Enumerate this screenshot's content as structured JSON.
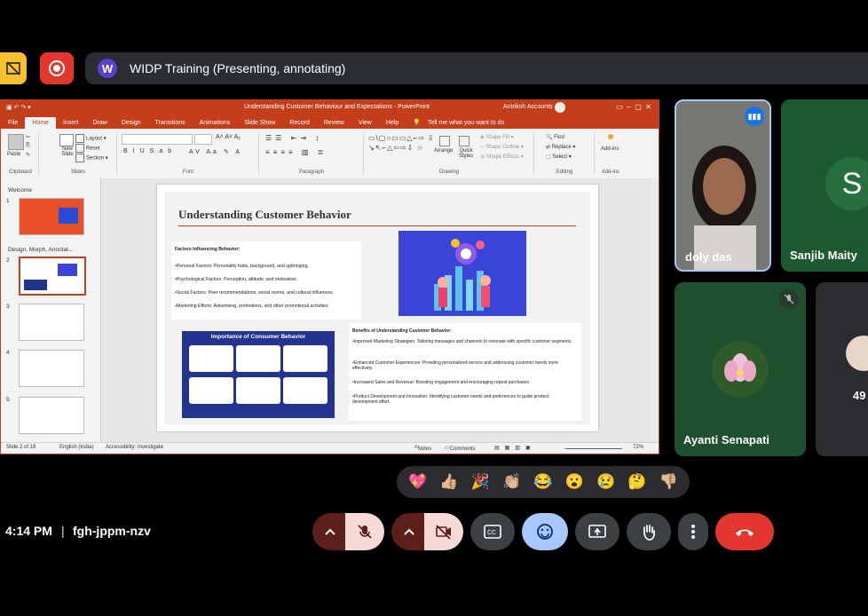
{
  "meeting": {
    "presenting_title": "WIDP Training (Presenting, annotating)",
    "presenter_initial": "W",
    "time": "4:14 PM",
    "separator": "|",
    "code": "fgh-jppm-nzv"
  },
  "ppt": {
    "window_title": "Understanding Customer Behaviour and Expectations  -  PowerPoint",
    "account": "Antriksh Accounts",
    "menu": [
      "File",
      "Home",
      "Insert",
      "Draw",
      "Design",
      "Transitions",
      "Animations",
      "Slide Show",
      "Record",
      "Review",
      "View",
      "Help"
    ],
    "tell_me": "Tell me what you want to do",
    "ribbon": {
      "paste": "Paste",
      "new_slide": "New Slide",
      "layout": "Layout",
      "reset": "Reset",
      "section": "Section",
      "arrange": "Arrange",
      "quick_styles": "Quick Styles",
      "shape_fill": "Shape Fill",
      "shape_outline": "Shape Outline",
      "shape_effects": "Shape Effects",
      "find": "Find",
      "replace": "Replace",
      "select": "Select",
      "add_ins": "Add-ins",
      "groups": [
        "Clipboard",
        "Slides",
        "Font",
        "Paragraph",
        "Drawing",
        "Editing",
        "Add-ins"
      ]
    },
    "sections": [
      "Welcome",
      "Design, Morph, Annotat..."
    ],
    "thumb_numbers": [
      "1",
      "2",
      "3",
      "4",
      "5"
    ],
    "slide": {
      "title": "Understanding Customer Behavior",
      "factors_heading": "Factors Influencing Behavior:",
      "factors": [
        "•Personal Factors: Personality traits, background, and upbringing.",
        "•Psychological Factors: Perception, attitude, and motivation.",
        "•Social Factors: Peer recommendations, social norms, and cultural influences.",
        "•Marketing Efforts: Advertising, promotions, and other promotional activities."
      ],
      "importance_title": "Importance of Consumer Behavior",
      "benefits_heading": "Benefits of Understanding Customer Behavior:",
      "benefits": [
        "•Improved Marketing Strategies: Tailoring messages and channels to resonate with specific customer segments.",
        "•Enhanced Customer Experiences: Providing personalized service and addressing customer needs more effectively.",
        "•Increased Sales and Revenue: Boosting engagement and encouraging repeat purchases.",
        "•Product Development and Innovation: Identifying customer needs and preferences to guide product development effort."
      ]
    },
    "status": {
      "slide_of": "Slide 2 of 19",
      "language": "English (India)",
      "accessibility": "Accessibility: Investigate",
      "notes": "Notes",
      "comments": "Comments",
      "zoom": "72%"
    }
  },
  "participants": [
    {
      "name": "doly das"
    },
    {
      "name": "Sanjib Maity",
      "initial": "S"
    },
    {
      "name": "Ayanti Senapati"
    },
    {
      "count": "49"
    }
  ],
  "reactions": [
    "💖",
    "👍🏼",
    "🎉",
    "👏🏼",
    "😂",
    "😮",
    "😢",
    "🤔",
    "👎🏼"
  ],
  "colors": {
    "ppt_accent": "#c43e1c",
    "leave": "#e3362e",
    "presenting_chip": "#f9c12e",
    "emoji_active": "#a8c7fa"
  }
}
